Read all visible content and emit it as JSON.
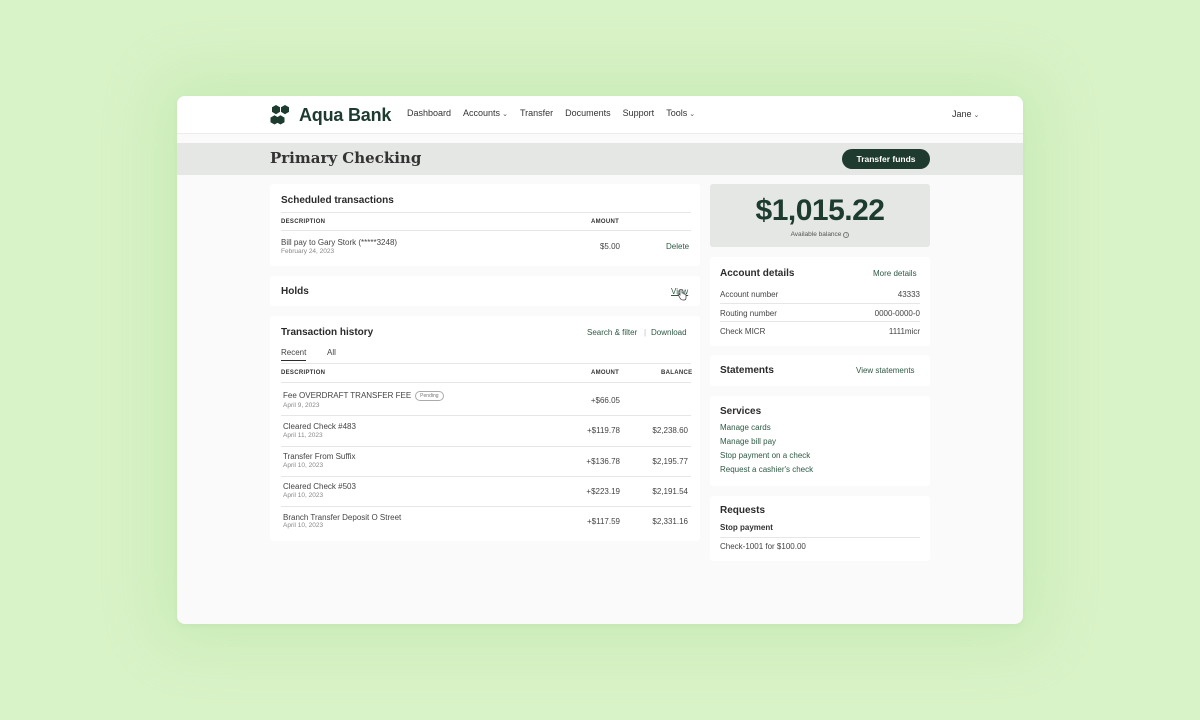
{
  "brand": {
    "name": "Aqua Bank",
    "color": "#1e3b30"
  },
  "nav": {
    "items": [
      {
        "label": "Dashboard",
        "dropdown": false
      },
      {
        "label": "Accounts",
        "dropdown": true
      },
      {
        "label": "Transfer",
        "dropdown": false
      },
      {
        "label": "Documents",
        "dropdown": false
      },
      {
        "label": "Support",
        "dropdown": false
      },
      {
        "label": "Tools",
        "dropdown": true
      }
    ],
    "user": "Jane"
  },
  "header": {
    "title": "Primary Checking",
    "action_label": "Transfer funds"
  },
  "scheduled": {
    "title": "Scheduled transactions",
    "col_description": "DESCRIPTION",
    "col_amount": "AMOUNT",
    "rows": [
      {
        "description": "Bill pay to Gary Stork (*****3248)",
        "date": "February 24, 2023",
        "amount": "$5.00",
        "action": "Delete"
      }
    ]
  },
  "holds": {
    "title": "Holds",
    "action": "View"
  },
  "history": {
    "title": "Transaction history",
    "search_link": "Search & filter",
    "separator": "|",
    "download_link": "Download",
    "tabs": [
      "Recent",
      "All"
    ],
    "col_description": "DESCRIPTION",
    "col_amount": "AMOUNT",
    "col_balance": "BALANCE",
    "pending_label": "Pending",
    "rows": [
      {
        "description": "Fee OVERDRAFT TRANSFER FEE",
        "date": "April 9, 2023",
        "amount": "+$66.05",
        "balance": "",
        "pending": true
      },
      {
        "description": "Cleared Check #483",
        "date": "April 11, 2023",
        "amount": "+$119.78",
        "balance": "$2,238.60",
        "pending": false
      },
      {
        "description": "Transfer From Suffix",
        "date": "April 10, 2023",
        "amount": "+$136.78",
        "balance": "$2,195.77",
        "pending": false
      },
      {
        "description": "Cleared Check #503",
        "date": "April 10, 2023",
        "amount": "+$223.19",
        "balance": "$2,191.54",
        "pending": false
      },
      {
        "description": "Branch Transfer Deposit O Street",
        "date": "April 10, 2023",
        "amount": "+$117.59",
        "balance": "$2,331.16",
        "pending": false
      }
    ]
  },
  "balance": {
    "amount": "$1,015.22",
    "label": "Available balance"
  },
  "account_details": {
    "title": "Account details",
    "more_link": "More details",
    "rows": [
      {
        "label": "Account number",
        "value": "43333"
      },
      {
        "label": "Routing number",
        "value": "0000-0000-0"
      },
      {
        "label": "Check MICR",
        "value": "1111micr"
      }
    ]
  },
  "statements": {
    "title": "Statements",
    "link": "View statements"
  },
  "services": {
    "title": "Services",
    "links": [
      "Manage cards",
      "Manage bill pay",
      "Stop payment on a check",
      "Request a cashier's check"
    ]
  },
  "requests": {
    "title": "Requests",
    "subtitle": "Stop payment",
    "item": "Check-1001 for $100.00"
  },
  "colors": {
    "accent": "#1f3a2e",
    "link": "#2f5a45",
    "background": "#d9f3c8"
  }
}
